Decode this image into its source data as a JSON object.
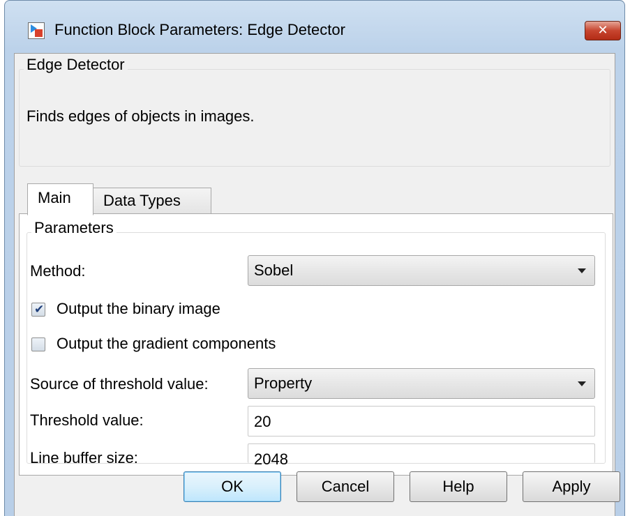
{
  "window": {
    "title": "Function Block Parameters: Edge Detector",
    "close_label": "✕"
  },
  "description": {
    "group_title": "Edge Detector",
    "text": "Finds edges of objects in images."
  },
  "tabs": [
    {
      "label": "Main",
      "selected": true
    },
    {
      "label": "Data Types",
      "selected": false
    }
  ],
  "parameters": {
    "group_title": "Parameters",
    "method": {
      "label": "Method:",
      "value": "Sobel"
    },
    "output_binary": {
      "label": "Output the binary image",
      "checked": true
    },
    "output_gradient": {
      "label": "Output the gradient components",
      "checked": false
    },
    "threshold_source": {
      "label": "Source of threshold value:",
      "value": "Property"
    },
    "threshold_value": {
      "label": "Threshold value:",
      "value": "20"
    },
    "line_buffer": {
      "label": "Line buffer size:",
      "value": "2048"
    }
  },
  "buttons": {
    "ok": "OK",
    "cancel": "Cancel",
    "help": "Help",
    "apply": "Apply"
  },
  "icons": {
    "app": "simulink-block-icon",
    "check": "✔"
  }
}
